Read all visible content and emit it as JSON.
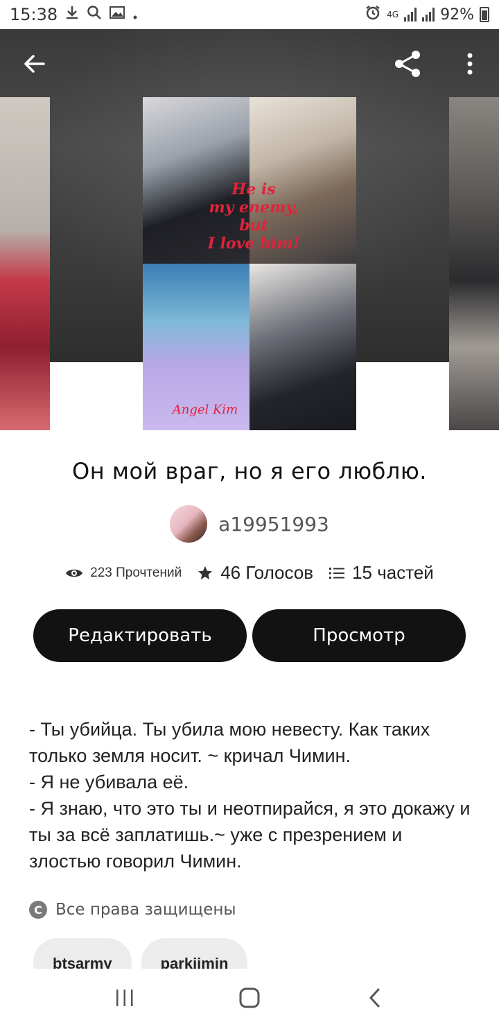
{
  "status_bar": {
    "time": "15:38",
    "network": "4G",
    "battery": "92%"
  },
  "cover": {
    "title_lines": [
      "He is",
      "my enemy,",
      "but",
      "I love him!"
    ],
    "author_sign": "Angel Kim"
  },
  "story": {
    "title": "Он мой враг, но я его люблю.",
    "author": "a19951993",
    "reads": "223 Прочтений",
    "votes": "46 Голосов",
    "parts": "15 частей"
  },
  "actions": {
    "edit_label": "Редактировать",
    "view_label": "Просмотр"
  },
  "description": [
    "- Ты убийца. Ты убила мою невесту. Как таких только земля носит. ~ кричал Чимин.",
    "- Я не убивала её.",
    "- Я знаю, что это ты и неотпирайся, я это докажу и ты за всё заплатишь.~ уже с презрением и злостью говорил Чимин."
  ],
  "copyright": {
    "icon_letter": "C",
    "text": "Все права защищены"
  },
  "tags": [
    "btsarmy",
    "parkjimin"
  ],
  "colors": {
    "button_bg": "#121212",
    "tag_bg": "#ececec",
    "cover_title": "#e0233b"
  }
}
